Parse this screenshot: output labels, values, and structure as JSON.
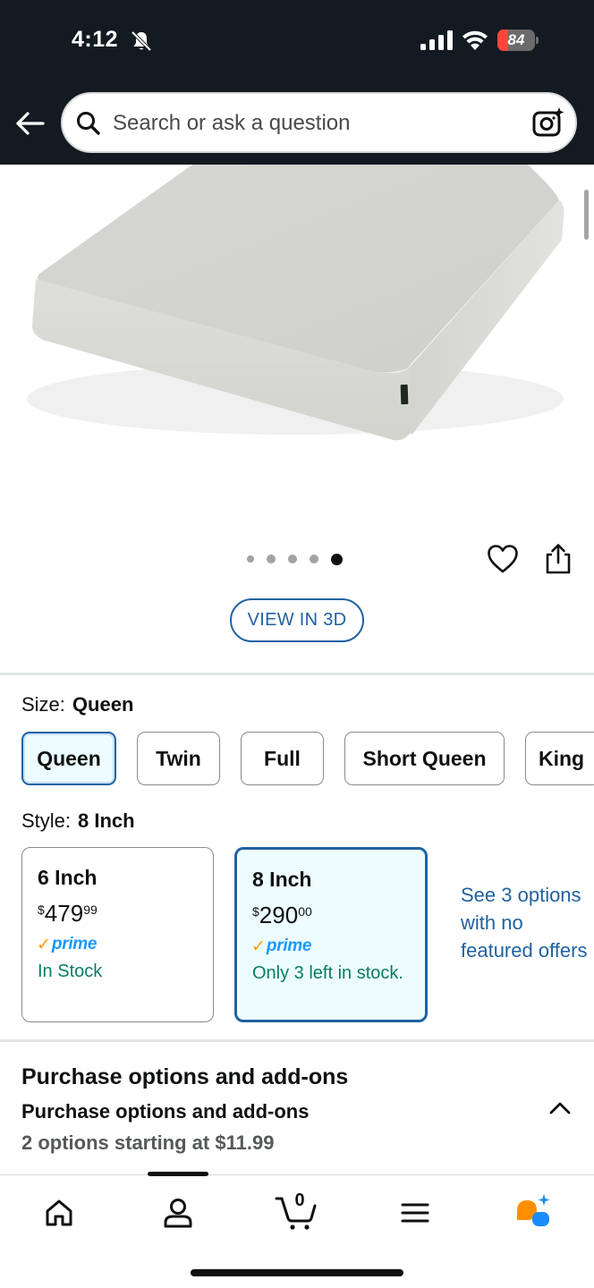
{
  "status_bar": {
    "time": "4:12",
    "battery": "84"
  },
  "search": {
    "placeholder": "Search or ask a question"
  },
  "gallery": {
    "image_count": 5,
    "active_index": 4,
    "view_3d_label": "VIEW IN 3D"
  },
  "size": {
    "label": "Size:",
    "selected": "Queen",
    "options": [
      "Queen",
      "Twin",
      "Full",
      "Short Queen",
      "King"
    ]
  },
  "style": {
    "label": "Style:",
    "selected": "8 Inch",
    "cards": [
      {
        "name": "6 Inch",
        "currency": "$",
        "price_whole": "479",
        "price_fraction": "99",
        "prime": "prime",
        "stock": "In Stock"
      },
      {
        "name": "8 Inch",
        "currency": "$",
        "price_whole": "290",
        "price_fraction": "00",
        "prime": "prime",
        "stock": "Only 3 left in stock."
      }
    ],
    "see_options": "See 3 options with no featured offers"
  },
  "purchase_options": {
    "title": "Purchase options and add-ons",
    "subtitle": "Purchase options and add-ons",
    "summary": "2 options starting at $11.99"
  },
  "bottom_nav": {
    "items": [
      "home-icon",
      "account-icon",
      "cart-icon",
      "menu-icon",
      "rufus-icon"
    ],
    "cart_count": "0"
  },
  "colors": {
    "header_bg": "#131a22",
    "link_blue": "#2162a1",
    "selected_bg": "#edfdff",
    "stock_green": "#067d62",
    "prime_orange": "#ff9900",
    "prime_blue": "#1a98ff"
  }
}
